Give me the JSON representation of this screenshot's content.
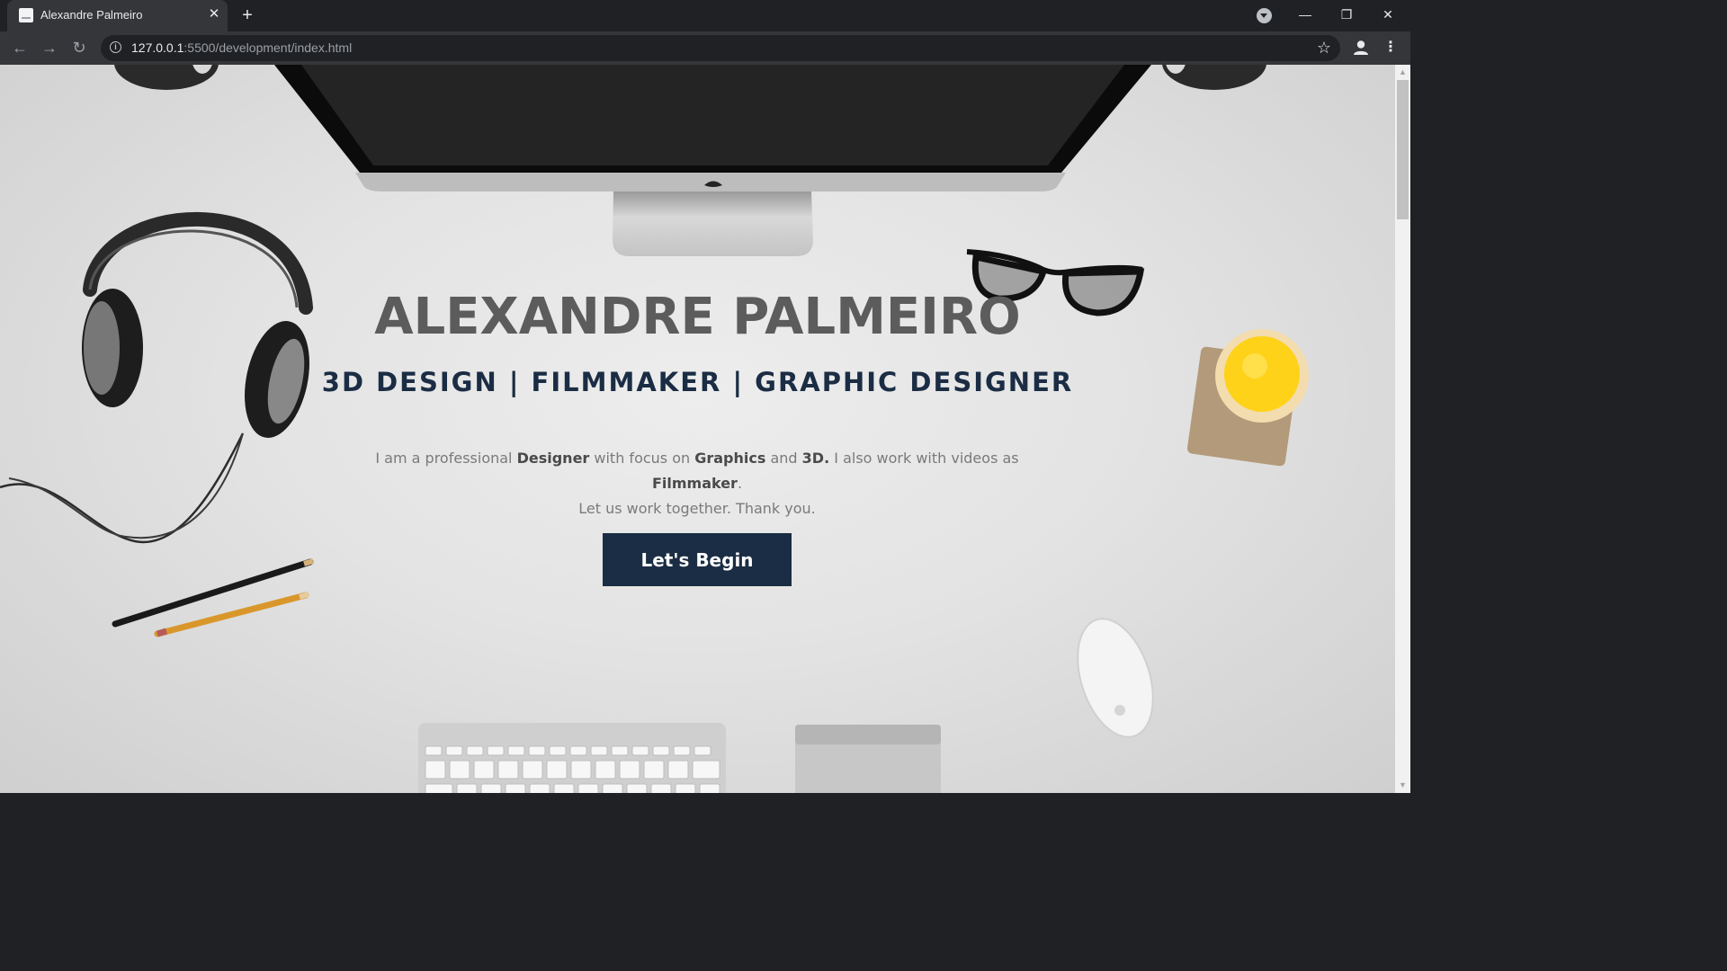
{
  "browser": {
    "tab_title": "Alexandre Palmeiro",
    "tab_close": "✕",
    "new_tab": "+",
    "url_host": "127.0.0.1",
    "url_path": ":5500/development/index.html",
    "window_controls": {
      "minimize": "—",
      "restore": "❐",
      "close": "✕"
    },
    "nav": {
      "back": "←",
      "forward": "→",
      "reload": "↻"
    },
    "info": "i",
    "star": "☆",
    "menu": "⋮"
  },
  "hero": {
    "title": "ALEXANDRE PALMEIRO",
    "subtitle": "3D DESIGN | FILMMAKER | GRAPHIC DESIGNER",
    "intro_1": "I am a professional ",
    "intro_designer": "Designer",
    "intro_2": " with focus on ",
    "intro_graphics": "Graphics",
    "intro_3": " and ",
    "intro_3d": "3D.",
    "intro_4": " I also work with videos as ",
    "intro_filmmaker": "Filmmaker",
    "intro_5": ".",
    "intro_line2": "Let us work together. Thank you.",
    "button_label": "Let's Begin"
  },
  "colors": {
    "accent_navy": "#1b2d44",
    "title_gray": "#5c5c5c",
    "chrome_dark": "#202124",
    "chrome_mid": "#35363a"
  },
  "icons": [
    "favicon",
    "close-icon",
    "plus-icon",
    "tab-search-icon",
    "minimize-icon",
    "restore-icon",
    "back-icon",
    "forward-icon",
    "reload-icon",
    "info-icon",
    "star-icon",
    "profile-icon",
    "menu-icon"
  ]
}
